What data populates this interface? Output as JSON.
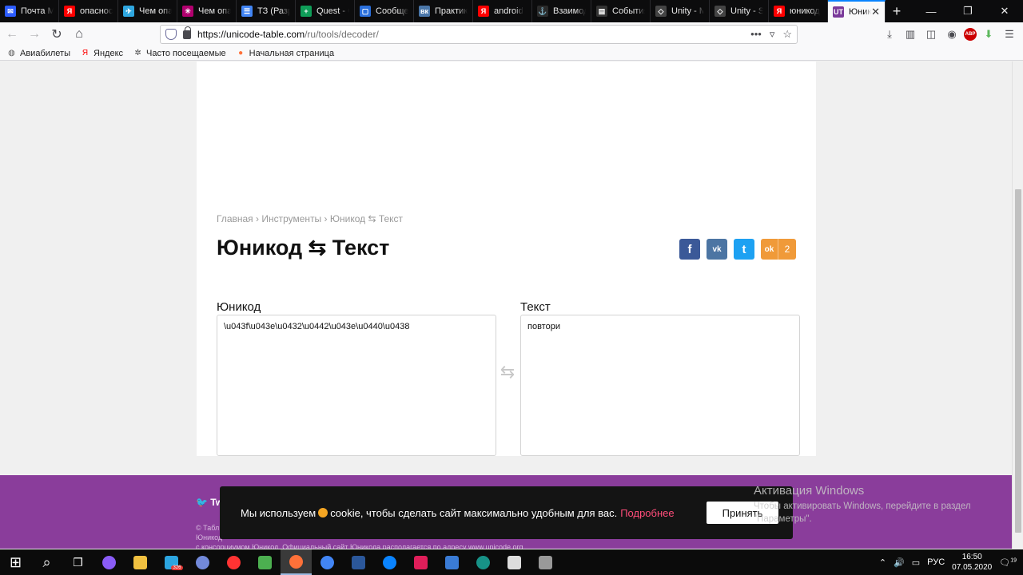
{
  "tabs": [
    {
      "label": "Почта Mail.ru",
      "color": "#2c5cff",
      "glyph": "✉",
      "active": false
    },
    {
      "label": "опасность",
      "color": "#ff0000",
      "glyph": "Я",
      "active": false
    },
    {
      "label": "Чем опасен",
      "color": "#2fa7e0",
      "glyph": "✈",
      "active": false
    },
    {
      "label": "Чем опасен",
      "color": "#b1006e",
      "glyph": "✳",
      "active": false
    },
    {
      "label": "ТЗ (Разр",
      "color": "#4285f4",
      "glyph": "☰",
      "active": false
    },
    {
      "label": "Quest - G",
      "color": "#0f9d58",
      "glyph": "+",
      "active": false
    },
    {
      "label": "Сообщения",
      "color": "#2a6fdb",
      "glyph": "▢",
      "active": false
    },
    {
      "label": "Практика",
      "color": "#4a76a8",
      "glyph": "вк",
      "active": false
    },
    {
      "label": "android",
      "color": "#ff0000",
      "glyph": "Я",
      "active": false
    },
    {
      "label": "Взаимоде",
      "color": "#2a2a2a",
      "glyph": "⚓",
      "active": false
    },
    {
      "label": "События",
      "color": "#333333",
      "glyph": "▤",
      "active": false
    },
    {
      "label": "Unity - M",
      "color": "#444444",
      "glyph": "◇",
      "active": false
    },
    {
      "label": "Unity - S",
      "color": "#444444",
      "glyph": "◇",
      "active": false
    },
    {
      "label": "юникод",
      "color": "#ff0000",
      "glyph": "Я",
      "active": false
    },
    {
      "label": "Юник",
      "color": "#7a3a9a",
      "glyph": "UT",
      "active": true
    }
  ],
  "window_controls": {
    "minimize": "—",
    "restore": "❐",
    "close": "✕"
  },
  "nav": {
    "url_host": "https://unicode-table.com",
    "url_path": "/ru/tools/decoder/",
    "more_label": "•••"
  },
  "bookmarks": [
    {
      "label": "Авиабилеты",
      "icon": "globe-icon"
    },
    {
      "label": "Яндекс",
      "icon": "yandex-icon"
    },
    {
      "label": "Часто посещаемые",
      "icon": "gear-icon"
    },
    {
      "label": "Начальная страница",
      "icon": "firefox-icon"
    }
  ],
  "page": {
    "breadcrumb": [
      {
        "label": "Главная",
        "link": true
      },
      {
        "label": "Инструменты",
        "link": true
      },
      {
        "label": "Юникод ⇆ Текст",
        "link": false
      }
    ],
    "breadcrumb_sep": " › ",
    "title": "Юникод ⇆ Текст",
    "share": {
      "fb": "f",
      "vk": "vk",
      "tw": "t",
      "ok_glyph": "ok",
      "ok_count": "2"
    },
    "unicode_label": "Юникод",
    "unicode_value": "\\u043f\\u043e\\u0432\\u0442\\u043e\\u0440\\u0438",
    "text_label": "Текст",
    "text_value": "повтори",
    "swap_glyph": "⇆"
  },
  "footer": {
    "twitter": "Tw",
    "copy_line1": "© Табл",
    "copy_line2": "Юникод",
    "copy_line3": "с консорциумом Юникод. Официальный сайт Юникода располагается по адресу www.unicode.org"
  },
  "cookie": {
    "text_before": "Мы используем",
    "text_after": "cookie, чтобы сделать сайт максимально удобным для вас.",
    "more": "Подробнее",
    "accept": "Принять"
  },
  "windows_activation": {
    "title": "Активация Windows",
    "subtitle": "Чтобы активировать Windows, перейдите в раздел \"Параметры\"."
  },
  "taskbar": {
    "apps": [
      {
        "name": "start",
        "color": "#ffffff"
      },
      {
        "name": "search",
        "color": "#ffffff"
      },
      {
        "name": "task-view",
        "color": "#ffffff"
      },
      {
        "name": "cortana",
        "color": "#8a5cf6"
      },
      {
        "name": "explorer",
        "color": "#f0c040"
      },
      {
        "name": "telegram",
        "color": "#2ca5e0"
      },
      {
        "name": "discord",
        "color": "#7289da"
      },
      {
        "name": "yandex",
        "color": "#ff3333"
      },
      {
        "name": "kaspersky",
        "color": "#4caf50"
      },
      {
        "name": "firefox",
        "color": "#ff7139"
      },
      {
        "name": "chrome",
        "color": "#4285f4"
      },
      {
        "name": "word",
        "color": "#2b579a"
      },
      {
        "name": "firefox-dev",
        "color": "#0a84ff"
      },
      {
        "name": "slack",
        "color": "#e01e5a"
      },
      {
        "name": "network-app",
        "color": "#3a7bd5"
      },
      {
        "name": "gitkraken",
        "color": "#179287"
      },
      {
        "name": "unity",
        "color": "#dddddd"
      },
      {
        "name": "other",
        "color": "#999999"
      }
    ],
    "badge": "326",
    "lang": "РУС",
    "time": "16:50",
    "date": "07.05.2020",
    "notif": "19"
  }
}
